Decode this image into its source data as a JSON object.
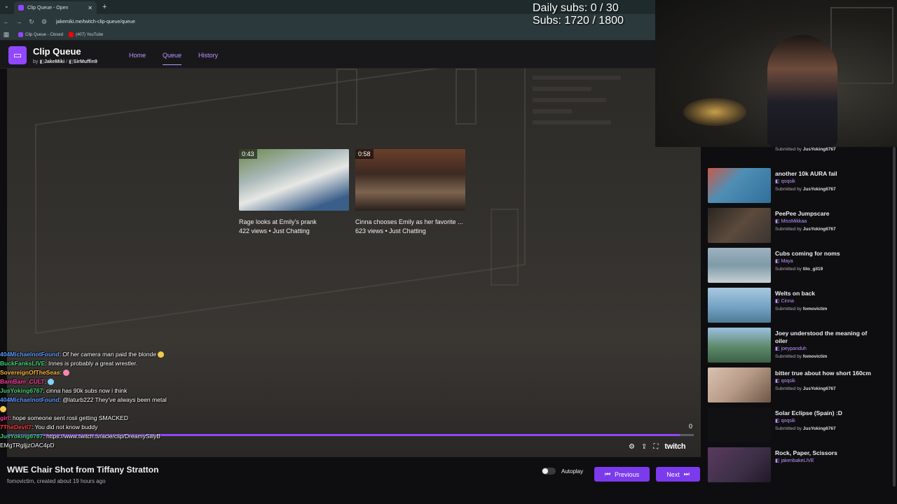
{
  "browser": {
    "tab_title": "Clip Queue - Open",
    "new_tab": "+",
    "url": "jakemiki.me/twitch-clip-queue/queue",
    "bookmarks": [
      "Clip Queue - Closed",
      "(407) YouTube"
    ]
  },
  "app": {
    "title": "Clip Queue",
    "by": "by",
    "author1": "JakeMiki",
    "sep": "/",
    "author2": "SirMuffin9",
    "nav": [
      "Home",
      "Queue",
      "History"
    ]
  },
  "overlay": {
    "daily_subs": "Daily subs: 0 / 30",
    "subs": "Subs: 1720 / 1800"
  },
  "recommendations": [
    {
      "duration": "0:43",
      "title": "Rage looks at Emily's prank",
      "meta": "422 views • Just Chatting"
    },
    {
      "duration": "0:58",
      "title": "Cinna chooses Emily as her favorite ...",
      "meta": "623 views • Just Chatting"
    }
  ],
  "player": {
    "counter": "0",
    "brand": "twitch",
    "progress": 0.98
  },
  "clip": {
    "title": "WWE Chair Shot from Tiffany Stratton",
    "meta": "fomovictim, created about 19 hours ago"
  },
  "controls": {
    "autoplay": "Autoplay",
    "autoplay_on": false,
    "previous": "Previous",
    "next": "Next"
  },
  "chat": [
    {
      "user": "404MichaelnotFound",
      "color": "#5b9bff",
      "text": ": Of her camera man paid the blonde"
    },
    {
      "user": "BuckFanksLIVE",
      "color": "#3fd27a",
      "text": ": Innes is probably a great wrestler."
    },
    {
      "user": "SovereignOfTheSeas",
      "color": "#ffb43b",
      "text": ":"
    },
    {
      "user": "BamBam_CULT",
      "color": "#ff3b9a",
      "text": ":"
    },
    {
      "user": "JusYoking6767",
      "color": "#3fd27a",
      "text": ": cinna has 90k subs now i think"
    },
    {
      "user": "404MichaelnotFound",
      "color": "#5b9bff",
      "text": ": @laturb222 They've always been metal"
    },
    {
      "user": "girl",
      "color": "#ff3b9a",
      "text": ": hope someone sent rosii getting SMACKED"
    },
    {
      "user": "7TheDevil7",
      "color": "#ff3b3b",
      "text": ": You did not know buddy"
    },
    {
      "user": "JusYoking6767",
      "color": "#3fd27a",
      "text": ": https://www.twitch.tv/acie/clip/DreamySillyB EMgTRgljjzOAC4pD"
    }
  ],
  "queue": {
    "top_submitted": "Submitted by",
    "top_submitter": "JusYoking6767",
    "items": [
      {
        "title": "another 10k AURA fail",
        "channel": "qoqsik",
        "submitted": "Submitted by",
        "submitter": "JusYoking6767",
        "color": "#4f8fb5"
      },
      {
        "title": "PeePee Jumpscare",
        "channel": "MissMikkaa",
        "submitted": "Submitted by",
        "submitter": "JusYoking6767",
        "color": "#3a3430"
      },
      {
        "title": "Cubs coming for noms",
        "channel": "Maya",
        "submitted": "Submitted by",
        "submitter": "tito_gil19",
        "color": "#7f9aa8"
      },
      {
        "title": "Welts on back",
        "channel": "Cinna",
        "submitted": "Submitted by",
        "submitter": "fomovictim",
        "color": "#6f9fc0"
      },
      {
        "title": "Joey understood the meaning of oiler",
        "channel": "joeypanduh",
        "submitted": "Submitted by",
        "submitter": "fomovictim",
        "color": "#5d8a6a"
      },
      {
        "title": "bitter true about how short 160cm",
        "channel": "qoqsik",
        "submitted": "Submitted by",
        "submitter": "JusYoking6767",
        "color": "#b79a86"
      },
      {
        "title": "Solar Eclipse (Spain) :D",
        "channel": "qoqsik",
        "submitted": "Submitted by",
        "submitter": "JusYoking6767",
        "color": "#111114"
      },
      {
        "title": "Rock, Paper, Scissors",
        "channel": "jakenbakeLIVE",
        "submitted": "",
        "submitter": "",
        "color": "#3b2f45"
      }
    ]
  }
}
